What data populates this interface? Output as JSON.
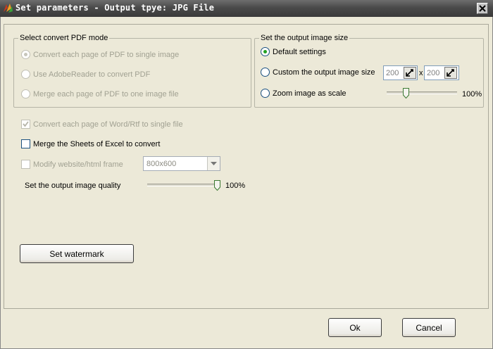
{
  "window": {
    "title": "Set parameters - Output tpye: JPG File"
  },
  "pdf_mode": {
    "legend": "Select convert PDF mode",
    "options": [
      {
        "label": "Convert each page of PDF to single image",
        "selected": true
      },
      {
        "label": "Use AdobeReader to convert PDF",
        "selected": false
      },
      {
        "label": "Merge each page of PDF to one image file",
        "selected": false
      }
    ]
  },
  "image_size": {
    "legend": "Set the output image size",
    "options": [
      {
        "label": "Default settings",
        "selected": true
      },
      {
        "label": "Custom the output image size",
        "selected": false
      },
      {
        "label": "Zoom image as scale",
        "selected": false
      }
    ],
    "width_value": "200",
    "height_value": "200",
    "separator": "x",
    "zoom_percent": "100%",
    "zoom_level": 0.25
  },
  "options": {
    "word_rtf_label": "Convert each page of Word/Rtf to single file",
    "word_rtf_checked": true,
    "excel_label": "Merge the Sheets of Excel to convert",
    "excel_checked": false,
    "website_label": "Modify website/html frame",
    "website_checked": false,
    "frame_size": "800x600"
  },
  "quality": {
    "label": "Set the output image quality",
    "percent": "100%",
    "level": 1.0
  },
  "buttons": {
    "watermark": "Set watermark",
    "ok": "Ok",
    "cancel": "Cancel"
  },
  "colors": {
    "dialog_bg": "#ece9d8",
    "radio_selected": "#21a121",
    "titlebar": "#4a4a4a"
  }
}
